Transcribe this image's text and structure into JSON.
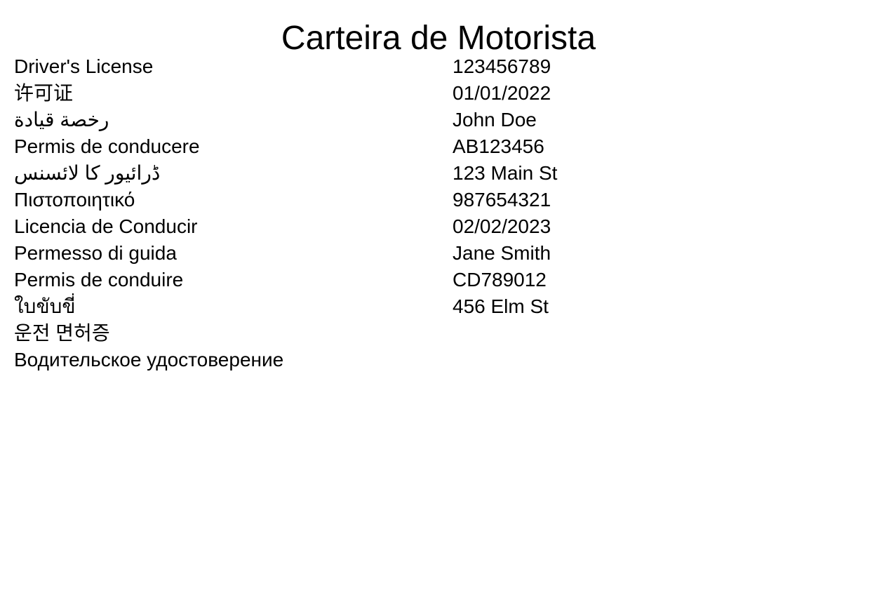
{
  "title": "Carteira de Motorista",
  "labels": [
    "Driver's License",
    "许可证",
    "رخصة قيادة",
    "Permis de conducere",
    "ڈرائیور کا لائسنس",
    "Πιστοποιητικό",
    "Licencia de Conducir",
    "Permesso di guida",
    "Permis de conduire",
    "ใบขับขี่",
    "운전 면허증",
    "Водительское удостоверение"
  ],
  "values": [
    "123456789",
    "01/01/2022",
    "John Doe",
    "AB123456",
    "123 Main St",
    "987654321",
    "02/02/2023",
    "Jane Smith",
    "CD789012",
    "456 Elm St"
  ]
}
